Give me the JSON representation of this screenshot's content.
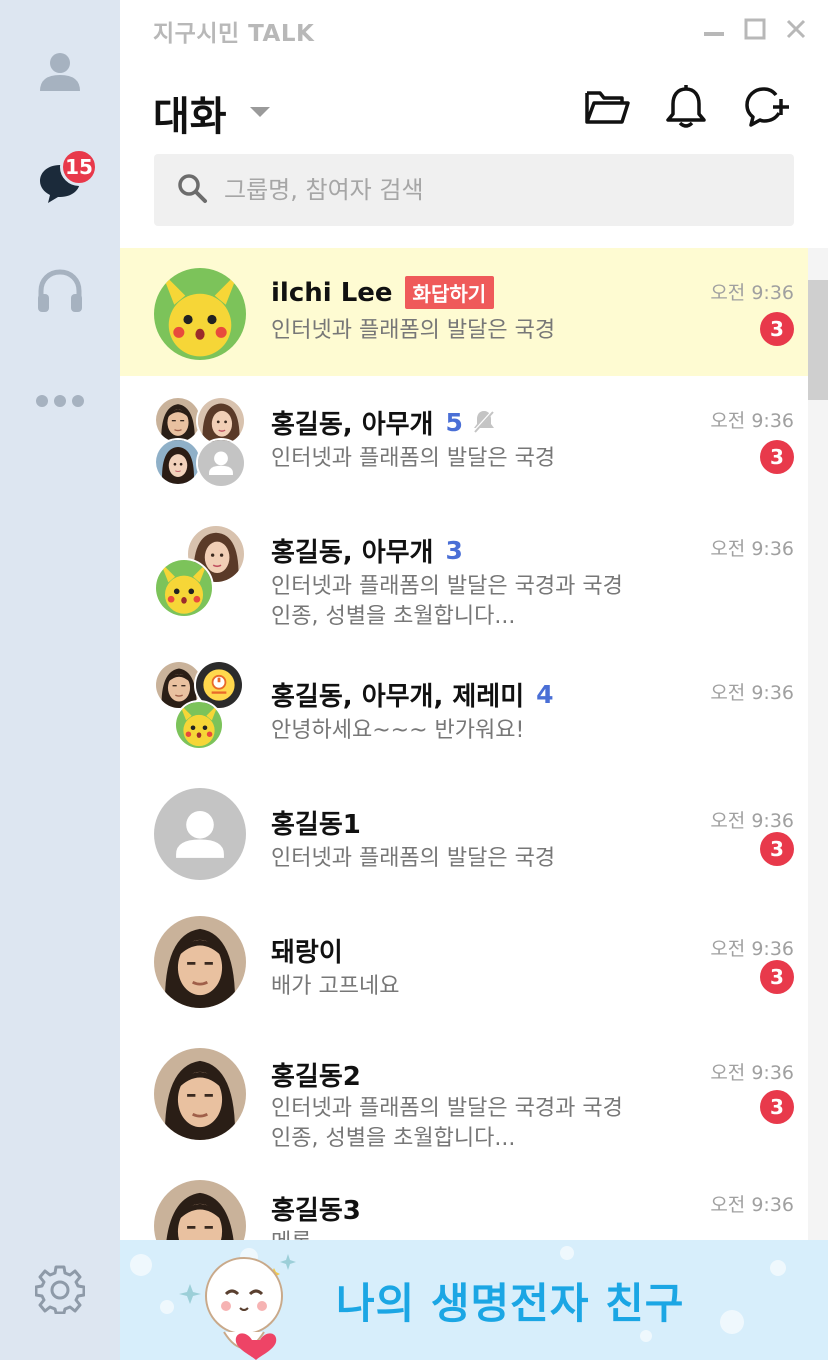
{
  "app": {
    "title": "지구시민 TALK"
  },
  "nav": {
    "chat_badge": "15"
  },
  "header": {
    "title": "대화"
  },
  "search": {
    "placeholder": "그룹명, 참여자 검색"
  },
  "conversations": [
    {
      "name": "ilchi Lee",
      "tag": "화답하기",
      "preview": [
        "인터넷과 플래폼의 발달은 국경"
      ],
      "time": "오전 9:36",
      "unread": "3",
      "highlight": true
    },
    {
      "name": "홍길동, 아무개",
      "member_count": "5",
      "muted": true,
      "preview": [
        "인터넷과 플래폼의 발달은 국경"
      ],
      "time": "오전 9:36",
      "unread": "3"
    },
    {
      "name": "홍길동, 아무개",
      "member_count": "3",
      "preview": [
        "인터넷과 플래폼의 발달은 국경과 국경",
        "인종, 성별을 초월합니다..."
      ],
      "time": "오전 9:36"
    },
    {
      "name": "홍길동, 아무개, 제레미",
      "member_count": "4",
      "preview": [
        "안녕하세요~~~ 반가워요!"
      ],
      "time": "오전 9:36"
    },
    {
      "name": "홍길동1",
      "preview": [
        "인터넷과 플래폼의 발달은 국경"
      ],
      "time": "오전 9:36",
      "unread": "3"
    },
    {
      "name": "돼랑이",
      "preview": [
        "배가 고프네요"
      ],
      "time": "오전 9:36",
      "unread": "3"
    },
    {
      "name": "홍길동2",
      "preview": [
        "인터넷과 플래폼의 발달은 국경과 국경",
        "인종, 성별을 초월합니다..."
      ],
      "time": "오전 9:36",
      "unread": "3"
    },
    {
      "name": "홍길동3",
      "preview": [
        "메롱"
      ],
      "time": "오전 9:36"
    }
  ],
  "banner": {
    "text": "나의 생명전자 친구"
  },
  "colors": {
    "accent_blue": "#4a6fd6",
    "badge_red": "#e8394b",
    "highlight_row": "#fefbd2",
    "rail": "#dde6f1",
    "banner_text": "#1ba6e4"
  }
}
